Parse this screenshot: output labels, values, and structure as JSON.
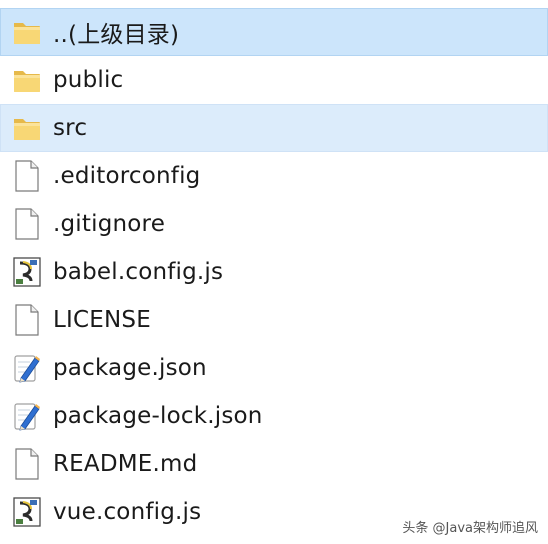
{
  "files": [
    {
      "name": "..(上级目录)",
      "icon": "folder-icon",
      "state": "selected"
    },
    {
      "name": "public",
      "icon": "folder-icon",
      "state": ""
    },
    {
      "name": "src",
      "icon": "folder-icon",
      "state": "hover"
    },
    {
      "name": ".editorconfig",
      "icon": "file-icon",
      "state": ""
    },
    {
      "name": ".gitignore",
      "icon": "file-icon",
      "state": ""
    },
    {
      "name": "babel.config.js",
      "icon": "script-icon",
      "state": ""
    },
    {
      "name": "LICENSE",
      "icon": "file-icon",
      "state": ""
    },
    {
      "name": "package.json",
      "icon": "edit-document-icon",
      "state": ""
    },
    {
      "name": "package-lock.json",
      "icon": "edit-document-icon",
      "state": ""
    },
    {
      "name": "README.md",
      "icon": "file-icon",
      "state": ""
    },
    {
      "name": "vue.config.js",
      "icon": "script-icon",
      "state": ""
    }
  ],
  "watermark": "头条 @Java架构师追风",
  "colors": {
    "selected_bg": "#cce5fb",
    "hover_bg": "#dcecfb",
    "folder": "#f6d56a"
  }
}
